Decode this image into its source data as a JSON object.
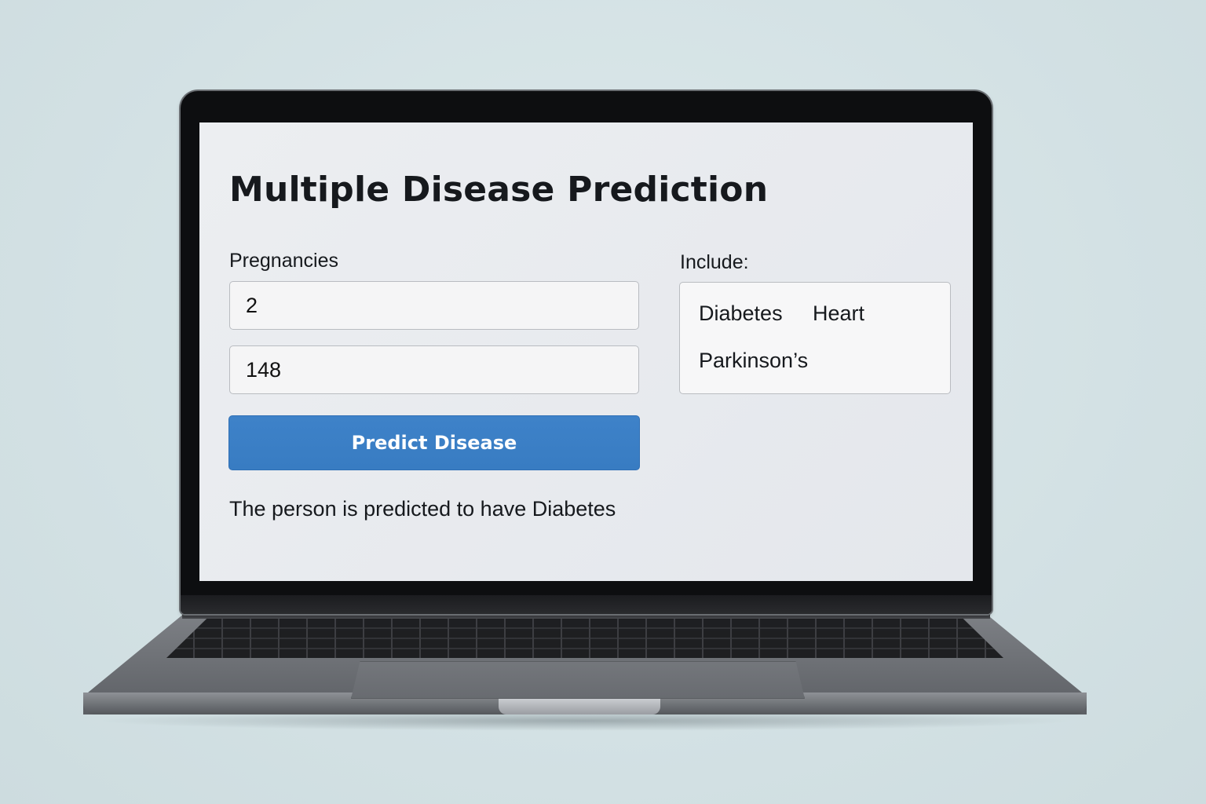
{
  "app": {
    "title": "Multiple Disease Prediction"
  },
  "form": {
    "pregnancies_label": "Pregnancies",
    "pregnancies_value": "2",
    "second_value": "148",
    "predict_button_label": "Predict Disease"
  },
  "include": {
    "label": "Include:",
    "options": [
      "Diabetes",
      "Heart",
      "Parkinson’s"
    ]
  },
  "result": {
    "text": "The person is predicted to have Diabetes"
  },
  "colors": {
    "accent": "#3b7fc6",
    "background": "#d5e3e6",
    "screen_bg": "#e8eaee"
  }
}
